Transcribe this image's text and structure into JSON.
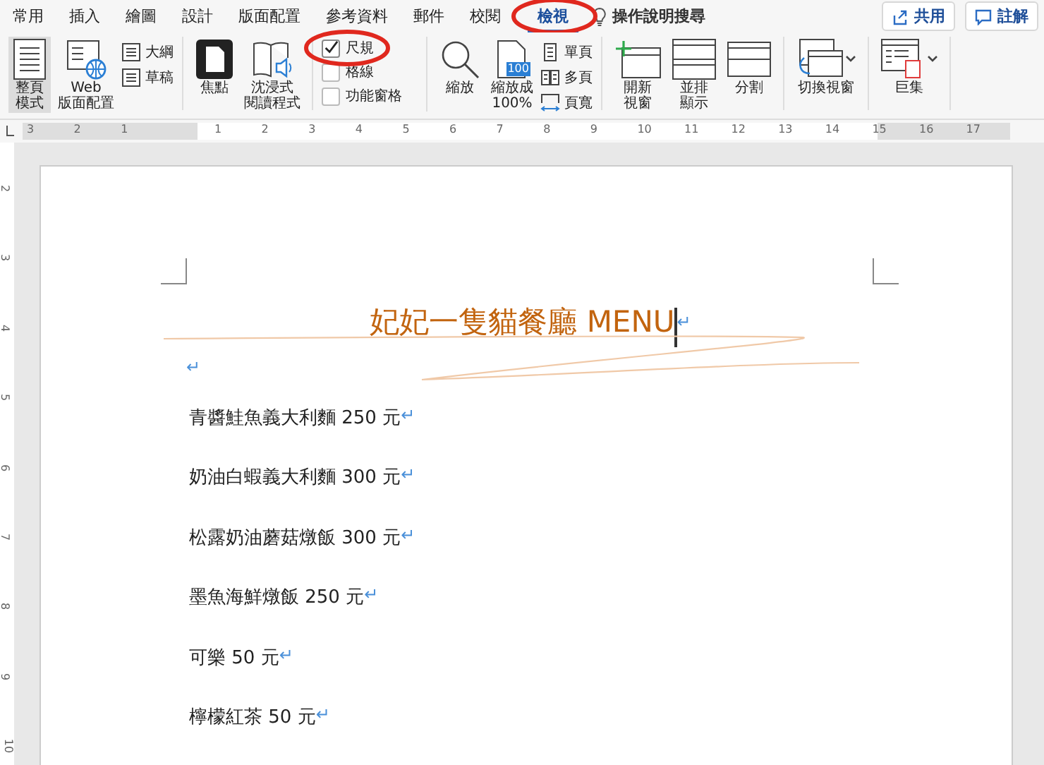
{
  "tabs": [
    {
      "label": "常用",
      "selected": false
    },
    {
      "label": "插入",
      "selected": false
    },
    {
      "label": "繪圖",
      "selected": false
    },
    {
      "label": "設計",
      "selected": false
    },
    {
      "label": "版面配置",
      "selected": false
    },
    {
      "label": "參考資料",
      "selected": false
    },
    {
      "label": "郵件",
      "selected": false
    },
    {
      "label": "校閱",
      "selected": false
    },
    {
      "label": "檢視",
      "selected": true
    }
  ],
  "help_search": "操作說明搜尋",
  "share_button": "共用",
  "comments_button": "註解",
  "ribbon": {
    "groups": [
      {
        "items": [
          {
            "kind": "large",
            "label_lines": [
              "整頁",
              "模式"
            ],
            "selected": true
          },
          {
            "kind": "large",
            "label_lines": [
              "Web",
              "版面配置"
            ],
            "selected": false
          },
          {
            "kind": "small",
            "label": "大綱"
          },
          {
            "kind": "small",
            "label": "草稿"
          }
        ]
      },
      {
        "items": [
          {
            "kind": "large",
            "label_lines": [
              "焦點"
            ],
            "selected": false
          },
          {
            "kind": "large",
            "label_lines": [
              "沈浸式",
              "閱讀程式"
            ],
            "selected": false
          }
        ]
      },
      {
        "items": [
          {
            "kind": "check",
            "label": "尺規",
            "checked": true
          },
          {
            "kind": "check",
            "label": "格線",
            "checked": false
          },
          {
            "kind": "check",
            "label": "功能窗格",
            "checked": false
          }
        ]
      },
      {
        "items": [
          {
            "kind": "large",
            "label_lines": [
              "縮放"
            ],
            "selected": false
          },
          {
            "kind": "large",
            "label_lines": [
              "縮放成",
              "100%"
            ],
            "badge": "100",
            "selected": false
          },
          {
            "kind": "small",
            "label": "單頁"
          },
          {
            "kind": "small",
            "label": "多頁"
          },
          {
            "kind": "small",
            "label": "頁寬"
          }
        ]
      },
      {
        "items": [
          {
            "kind": "large",
            "label_lines": [
              "開新",
              "視窗"
            ],
            "selected": false
          },
          {
            "kind": "large",
            "label_lines": [
              "並排",
              "顯示"
            ],
            "selected": false
          },
          {
            "kind": "large",
            "label_lines": [
              "分割"
            ],
            "selected": false
          }
        ]
      },
      {
        "items": [
          {
            "kind": "large",
            "label_lines": [
              "切換視窗"
            ],
            "dropdown": true,
            "selected": false
          }
        ]
      },
      {
        "items": [
          {
            "kind": "large",
            "label_lines": [
              "巨集"
            ],
            "dropdown": true,
            "selected": false
          }
        ]
      }
    ]
  },
  "ruler": {
    "left_numbers": [
      "3",
      "2",
      "1"
    ],
    "right_numbers": [
      "1",
      "2",
      "3",
      "4",
      "5",
      "6",
      "7",
      "8",
      "9",
      "10",
      "11",
      "12",
      "13",
      "14",
      "15",
      "16",
      "17"
    ]
  },
  "vertical_ruler": {
    "numbers": [
      "2",
      "3",
      "4",
      "5",
      "6",
      "7",
      "8",
      "9",
      "10"
    ]
  },
  "document": {
    "title": "妃妃一隻貓餐廳 MENU",
    "paragraph_mark": "↵",
    "empty_paragraph_mark": "↵",
    "lines": [
      {
        "text": "青醬鮭魚義大利麵 250 元",
        "mark": "↵"
      },
      {
        "text": "奶油白蝦義大利麵 300 元",
        "mark": "↵"
      },
      {
        "text": "松露奶油蘑菇燉飯 300 元",
        "mark": "↵"
      },
      {
        "text": "墨魚海鮮燉飯 250 元",
        "mark": "↵"
      },
      {
        "text": "可樂 50 元",
        "mark": "↵"
      },
      {
        "text": "檸檬紅茶 50 元",
        "mark": "↵"
      }
    ]
  }
}
